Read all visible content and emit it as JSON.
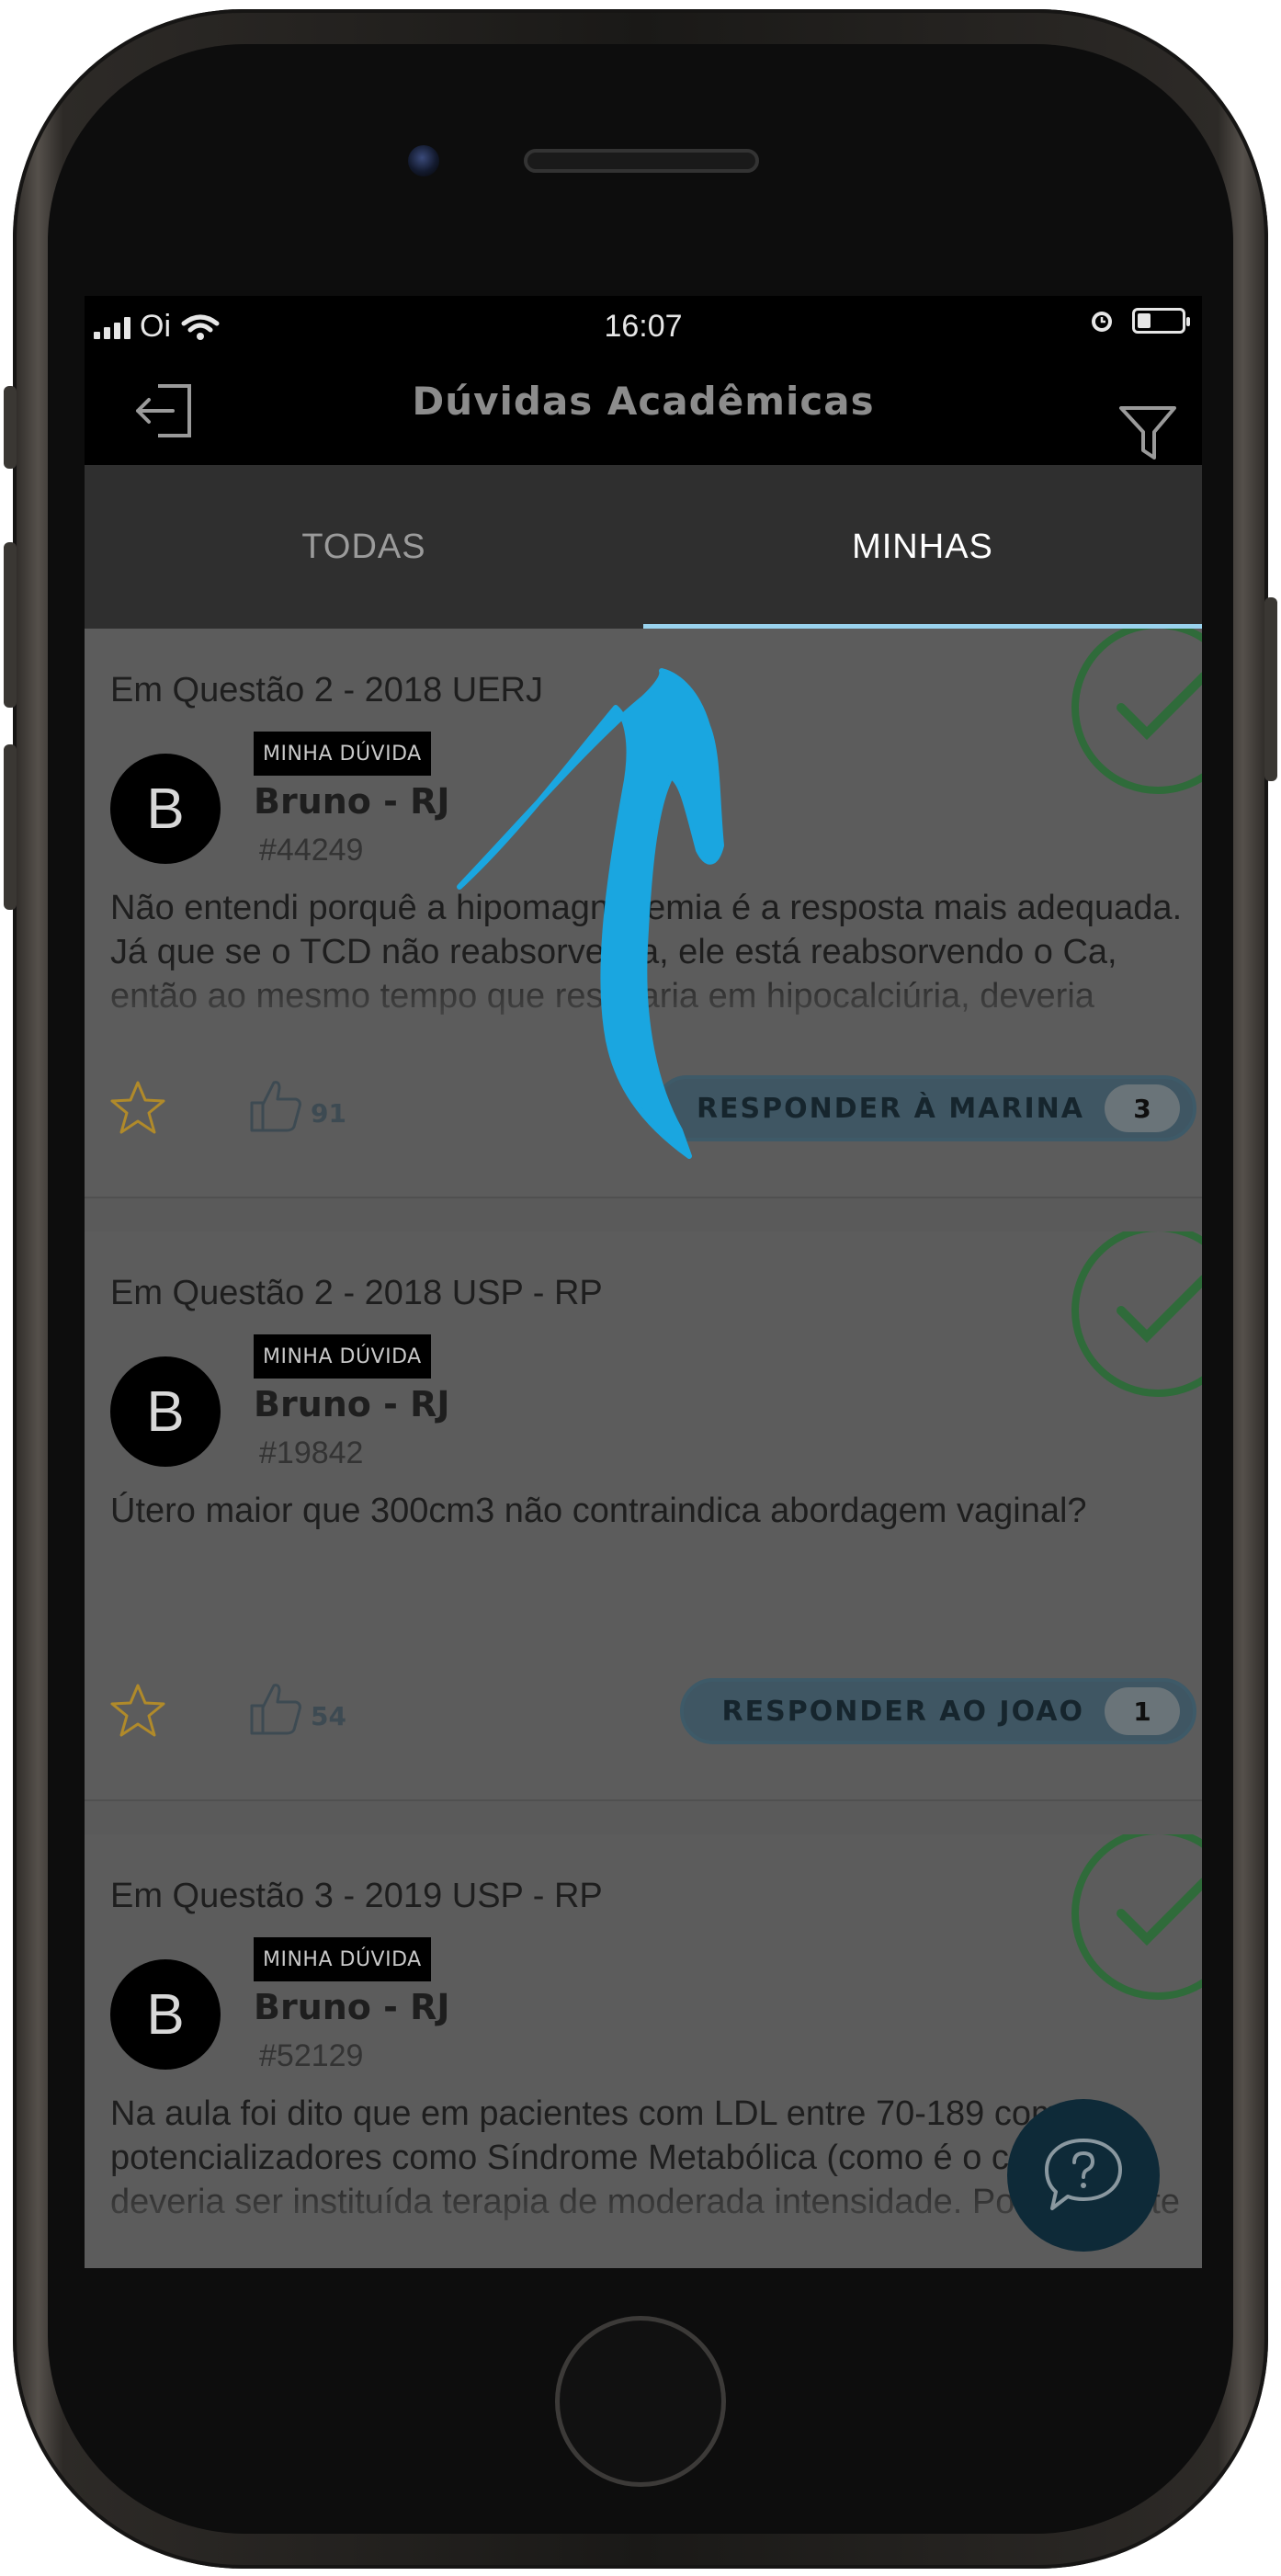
{
  "status_bar": {
    "carrier": "Oi",
    "time": "16:07"
  },
  "header": {
    "title": "Dúvidas Acadêmicas"
  },
  "tabs": [
    {
      "label": "TODAS",
      "active": false
    },
    {
      "label": "MINHAS",
      "active": true
    }
  ],
  "questions": [
    {
      "context": "Em Questão 2 - 2018 UERJ",
      "badge": "MINHA DÚVIDA",
      "avatar_letter": "B",
      "author": "Bruno - RJ",
      "id": "#44249",
      "text": "Não entendi porquê a hipomagnesemia é a resposta mais adequada. Já que se o TCD não reabsorve Na, ele está reabsorvendo o Ca, então ao mesmo tempo que resultaria em hipocalciúria, deveria resultar em hipercalcemia, não? Porquê",
      "likes": "91",
      "reply_label": "RESPONDER À MARINA",
      "reply_count": "3",
      "resolved": true
    },
    {
      "context": "Em Questão 2 - 2018 USP - RP",
      "badge": "MINHA DÚVIDA",
      "avatar_letter": "B",
      "author": "Bruno - RJ",
      "id": "#19842",
      "text": "Útero maior que 300cm3 não contraindica abordagem vaginal?",
      "likes": "54",
      "reply_label": "RESPONDER AO JOAO",
      "reply_count": "1",
      "resolved": true
    },
    {
      "context": "Em Questão 3 - 2019 USP - RP",
      "badge": "MINHA DÚVIDA",
      "avatar_letter": "B",
      "author": "Bruno - RJ",
      "id": "#52129",
      "text": "Na aula foi dito que em pacientes com LDL entre 70-189 com potencializadores como Síndrome Metabólica (como é o caso), deveria ser instituída terapia de moderada intensidade. Porque neste caso a conduta seria aumentar a sinvastatina",
      "resolved": true
    }
  ],
  "colors": {
    "tab_indicator": "#9ad3ee",
    "arrow": "#1aa6e0",
    "check": "#2f6b3a",
    "star": "#b08a2a",
    "reply_button": "#3f5663"
  },
  "icons": [
    "back-icon",
    "filter-icon",
    "star-icon",
    "thumbs-up-icon",
    "check-icon",
    "chat-help-icon",
    "annotation-arrow"
  ]
}
